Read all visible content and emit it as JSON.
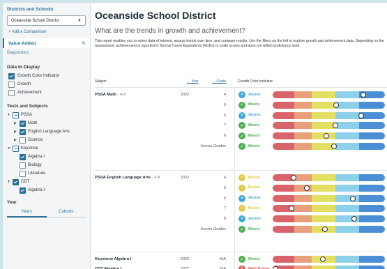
{
  "sidebar": {
    "districts_heading": "Districts and Schools",
    "district_select": "Oceanside School District",
    "add_comparison": "+ Add a Comparison",
    "value_added": "Value-Added",
    "diagnostics": "Diagnostics",
    "data_to_display_heading": "Data to Display",
    "display_options": [
      {
        "label": "Growth Color Indicator",
        "checked": true
      },
      {
        "label": "Growth",
        "checked": false
      },
      {
        "label": "Achievement",
        "checked": false
      }
    ],
    "tests_heading": "Tests and Subjects",
    "tree": {
      "pssa": "PSSA",
      "math": "Math",
      "ela": "English Language Arts",
      "science": "Science",
      "keystone": "Keystone",
      "algebra1": "Algebra I",
      "biology": "Biology",
      "literature": "Literature",
      "cdt": "CDT",
      "cdt_algebra1": "Algebra I"
    },
    "year_heading": "Year",
    "year_tabs": [
      "Years",
      "Cohorts"
    ]
  },
  "main": {
    "title": "Oceanside School District",
    "subtitle": "What are the trends in growth and achievement?",
    "description": "This report enables you to select data of interest, assess trends over time, and compare results. Use the filters on the left to explore growth and achievement data. Depending on the assessment, achievement is reported in Normal Curve Equivalents (NCEs) or scale scores and does not reflect proficiency level.",
    "headers": {
      "subject": "Subject",
      "year": "Year",
      "grade": "Grade",
      "indicator": "Growth Color Indicator"
    },
    "groups": [
      {
        "subject": "PSSA Math",
        "grades_label": "- 4-8",
        "year": "2022",
        "rows": [
          {
            "grade": "4",
            "status": "Above",
            "level": 0.8
          },
          {
            "grade": "5",
            "status": "Meets",
            "level": 0.56
          },
          {
            "grade": "6",
            "status": "Above",
            "level": 0.78
          },
          {
            "grade": "7",
            "status": "Meets",
            "level": 0.55
          },
          {
            "grade": "8",
            "status": "Meets",
            "level": 0.47
          },
          {
            "grade": "Across Grades",
            "status": "Meets",
            "level": 0.54
          }
        ]
      },
      {
        "subject": "PSSA English Language Arts",
        "grades_label": "- 4-8",
        "year": "2022",
        "rows": [
          {
            "grade": "4",
            "status": "Below",
            "level": 0.18
          },
          {
            "grade": "5",
            "status": "Below",
            "level": 0.3
          },
          {
            "grade": "6",
            "status": "Above",
            "level": 0.71
          },
          {
            "grade": "7",
            "status": "Below",
            "level": 0.16
          },
          {
            "grade": "8",
            "status": "Above",
            "level": 0.72
          },
          {
            "grade": "Across Grades",
            "status": "Meets",
            "level": 0.46
          }
        ]
      },
      {
        "subject": "Keystone Algebra I",
        "grades_label": "",
        "year": "2022",
        "rows": [
          {
            "grade": "N/A",
            "status": "Meets",
            "level": 0.44
          }
        ]
      },
      {
        "subject": "CDT Algebra I",
        "grades_label": "",
        "year": "2022",
        "rows": [
          {
            "grade": "N/A",
            "status": "Well Below",
            "level": 0.02
          }
        ]
      }
    ]
  },
  "colors": {
    "Above": "#3fa9d9",
    "Meets": "#4caf50",
    "Below": "#e3c94a",
    "Well Below": "#d9534f"
  },
  "badge_icons": {
    "Above": "plus-circle-icon",
    "Meets": "check-circle-icon",
    "Below": "minus-circle-icon",
    "Well Below": "double-minus-circle-icon"
  },
  "badge_glyphs": {
    "Above": "+",
    "Meets": "✓",
    "Below": "−",
    "Well Below": "‼"
  }
}
